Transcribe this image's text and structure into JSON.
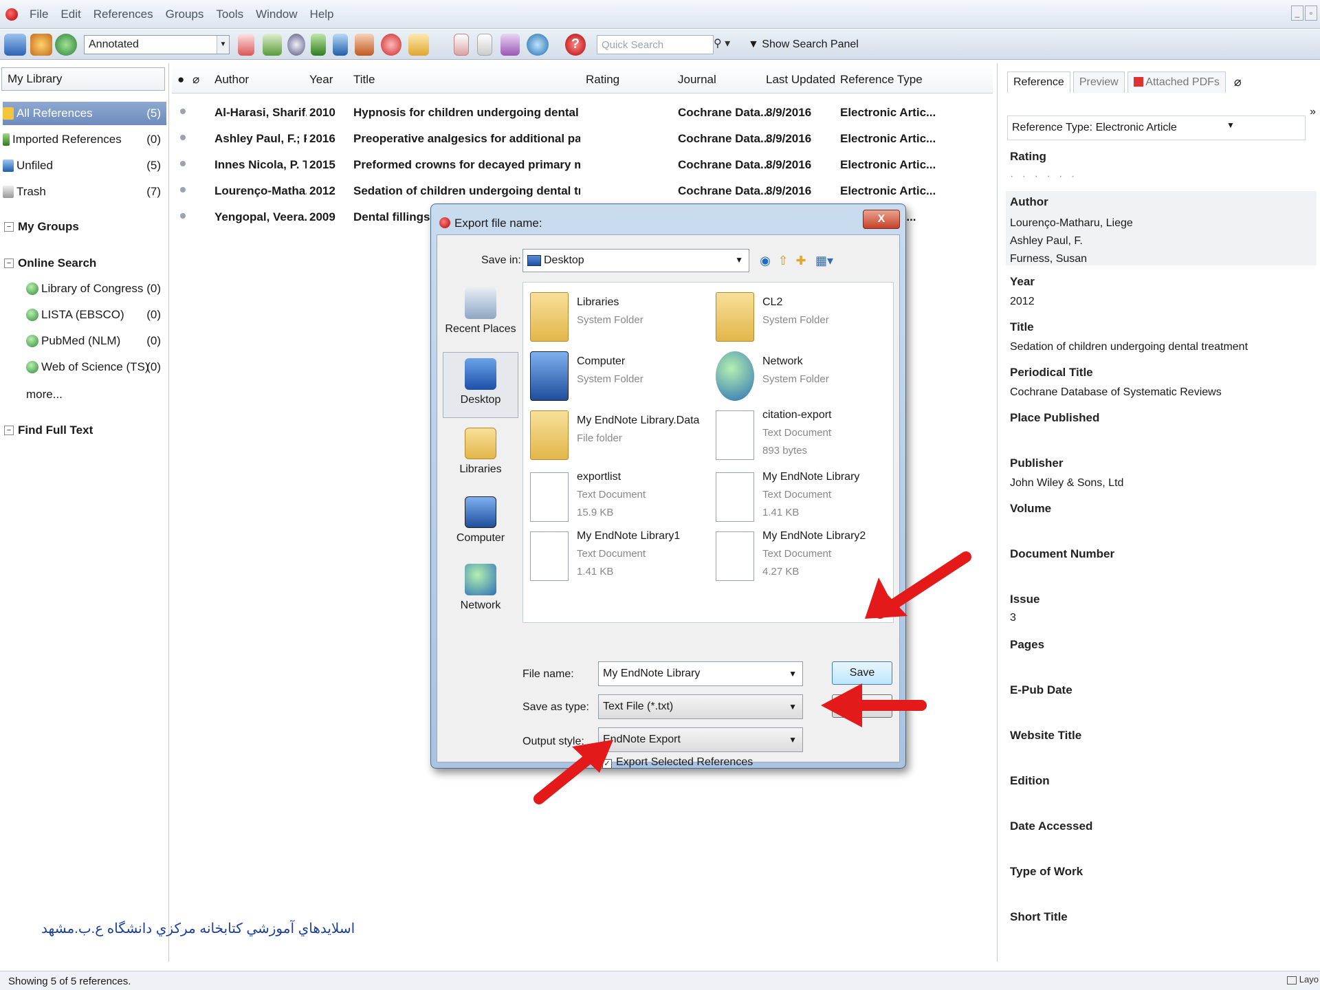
{
  "menu": [
    "File",
    "Edit",
    "References",
    "Groups",
    "Tools",
    "Window",
    "Help"
  ],
  "toolbar": {
    "style_value": "Annotated",
    "quick_search_placeholder": "Quick Search",
    "show_panel": "Show Search Panel"
  },
  "left": {
    "library_label": "My Library",
    "groups": [
      {
        "label": "All References",
        "count": "(5)"
      },
      {
        "label": "Imported References",
        "count": "(0)"
      },
      {
        "label": "Unfiled",
        "count": "(5)"
      },
      {
        "label": "Trash",
        "count": "(7)"
      }
    ],
    "my_groups": "My Groups",
    "online_search": "Online Search",
    "online_items": [
      {
        "label": "Library of Congress",
        "count": "(0)"
      },
      {
        "label": "LISTA (EBSCO)",
        "count": "(0)"
      },
      {
        "label": "PubMed (NLM)",
        "count": "(0)"
      },
      {
        "label": "Web of Science (TS)",
        "count": "(0)"
      }
    ],
    "more": "more...",
    "find_full_text": "Find Full Text"
  },
  "list": {
    "headers": {
      "author": "Author",
      "year": "Year",
      "title": "Title",
      "rating": "Rating",
      "journal": "Journal",
      "updated": "Last Updated",
      "type": "Reference Type"
    },
    "rows": [
      {
        "author": "Al-Harasi, Sharif...",
        "year": "2010",
        "title": "Hypnosis for children undergoing dental treat...",
        "journal": "Cochrane Data...",
        "updated": "8/9/2016",
        "type": "Electronic Artic..."
      },
      {
        "author": "Ashley Paul, F.; P...",
        "year": "2016",
        "title": "Preoperative analgesics for additional pain reli...",
        "journal": "Cochrane Data...",
        "updated": "8/9/2016",
        "type": "Electronic Artic..."
      },
      {
        "author": "Innes Nicola, P. T...",
        "year": "2015",
        "title": "Preformed crowns for decayed primary molar ...",
        "journal": "Cochrane Data...",
        "updated": "8/9/2016",
        "type": "Electronic Artic..."
      },
      {
        "author": "Lourenço-Matha...",
        "year": "2012",
        "title": "Sedation of children undergoing dental treatm...",
        "journal": "Cochrane Data...",
        "updated": "8/9/2016",
        "type": "Electronic Artic..."
      },
      {
        "author": "Yengopal, Veera...",
        "year": "2009",
        "title": "Dental fillings fo",
        "journal": "",
        "updated": "",
        "type": "...ic..."
      }
    ],
    "watermark": "اسلایدهاي آموزشي كتابخانه مركزي دانشگاه ع.ب.مشهد"
  },
  "right": {
    "tabs": [
      "Reference",
      "Preview",
      "Attached PDFs"
    ],
    "ref_type_label": "Reference Type:",
    "ref_type_value": "Electronic Article",
    "fields": [
      {
        "label": "Rating",
        "value": "· · · · · ·"
      },
      {
        "label": "Author",
        "value": "Lourenço-Matharu, Liege\nAshley Paul, F.\nFurness, Susan"
      },
      {
        "label": "Year",
        "value": "2012"
      },
      {
        "label": "Title",
        "value": "Sedation of children undergoing dental treatment"
      },
      {
        "label": "Periodical Title",
        "value": "Cochrane Database of Systematic Reviews"
      },
      {
        "label": "Place Published",
        "value": ""
      },
      {
        "label": "Publisher",
        "value": "John Wiley & Sons, Ltd"
      },
      {
        "label": "Volume",
        "value": ""
      },
      {
        "label": "Document Number",
        "value": ""
      },
      {
        "label": "Issue",
        "value": "3"
      },
      {
        "label": "Pages",
        "value": ""
      },
      {
        "label": "E-Pub Date",
        "value": ""
      },
      {
        "label": "Website Title",
        "value": ""
      },
      {
        "label": "Edition",
        "value": ""
      },
      {
        "label": "Date Accessed",
        "value": ""
      },
      {
        "label": "Type of Work",
        "value": ""
      },
      {
        "label": "Short Title",
        "value": ""
      }
    ]
  },
  "status": {
    "text": "Showing 5 of 5 references.",
    "layout": "Layo"
  },
  "dialog": {
    "title": "Export file name:",
    "close": "X",
    "save_in_label": "Save in:",
    "save_in_value": "Desktop",
    "places": [
      "Recent Places",
      "Desktop",
      "Libraries",
      "Computer",
      "Network"
    ],
    "files": [
      {
        "name": "Libraries",
        "type": "System Folder",
        "size": ""
      },
      {
        "name": "CL2",
        "type": "System Folder",
        "size": ""
      },
      {
        "name": "Computer",
        "type": "System Folder",
        "size": ""
      },
      {
        "name": "Network",
        "type": "System Folder",
        "size": ""
      },
      {
        "name": "My EndNote Library.Data",
        "type": "File folder",
        "size": ""
      },
      {
        "name": "citation-export",
        "type": "Text Document",
        "size": "893 bytes"
      },
      {
        "name": "exportlist",
        "type": "Text Document",
        "size": "15.9 KB"
      },
      {
        "name": "My EndNote Library",
        "type": "Text Document",
        "size": "1.41 KB"
      },
      {
        "name": "My EndNote Library1",
        "type": "Text Document",
        "size": "1.41 KB"
      },
      {
        "name": "My EndNote Library2",
        "type": "Text Document",
        "size": "4.27 KB"
      }
    ],
    "file_name_label": "File name:",
    "file_name_value": "My EndNote Library",
    "save_as_label": "Save as type:",
    "save_as_value": "Text File (*.txt)",
    "output_style_label": "Output style:",
    "output_style_value": "EndNote Export",
    "export_selected_label": "Export Selected References",
    "save_button": "Save",
    "cancel_button": "Cancel"
  },
  "colors": {
    "annotation_arrow": "#e41a1a",
    "selection": "#7b95c6"
  }
}
